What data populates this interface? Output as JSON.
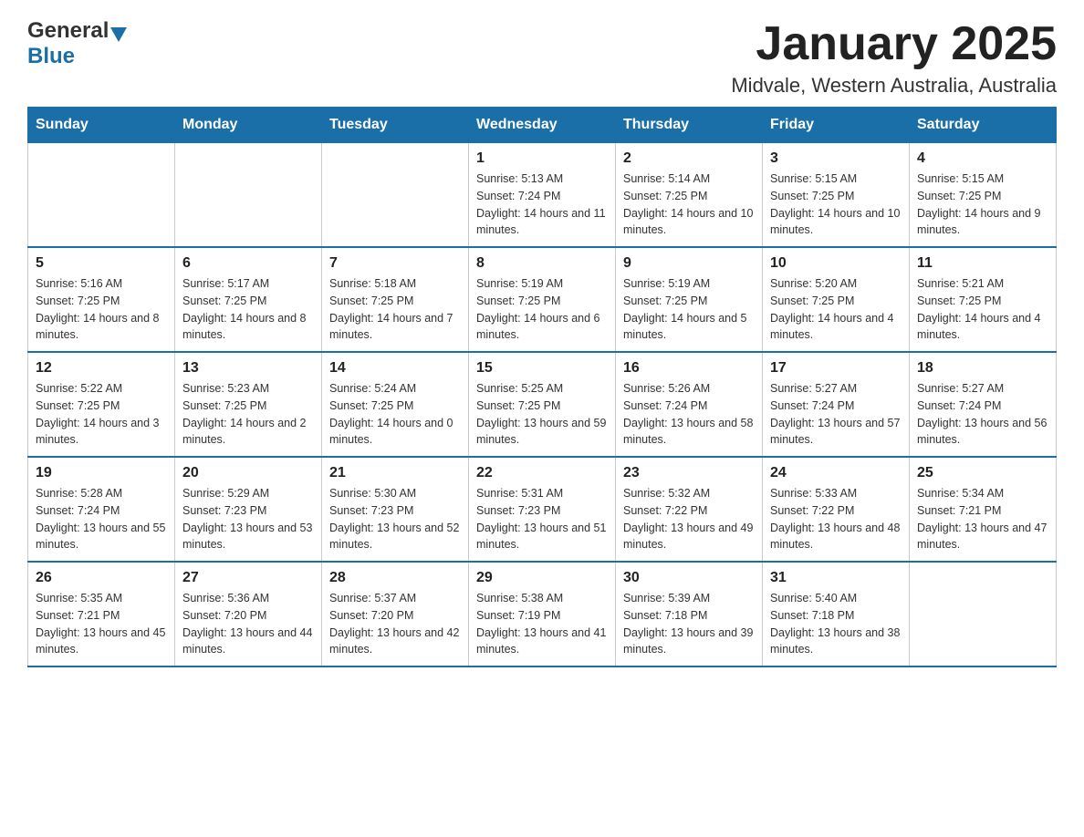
{
  "header": {
    "logo": {
      "general": "General",
      "blue": "Blue"
    },
    "title": "January 2025",
    "subtitle": "Midvale, Western Australia, Australia"
  },
  "calendar": {
    "days_of_week": [
      "Sunday",
      "Monday",
      "Tuesday",
      "Wednesday",
      "Thursday",
      "Friday",
      "Saturday"
    ],
    "weeks": [
      [
        {
          "day": "",
          "sunrise": "",
          "sunset": "",
          "daylight": ""
        },
        {
          "day": "",
          "sunrise": "",
          "sunset": "",
          "daylight": ""
        },
        {
          "day": "",
          "sunrise": "",
          "sunset": "",
          "daylight": ""
        },
        {
          "day": "1",
          "sunrise": "Sunrise: 5:13 AM",
          "sunset": "Sunset: 7:24 PM",
          "daylight": "Daylight: 14 hours and 11 minutes."
        },
        {
          "day": "2",
          "sunrise": "Sunrise: 5:14 AM",
          "sunset": "Sunset: 7:25 PM",
          "daylight": "Daylight: 14 hours and 10 minutes."
        },
        {
          "day": "3",
          "sunrise": "Sunrise: 5:15 AM",
          "sunset": "Sunset: 7:25 PM",
          "daylight": "Daylight: 14 hours and 10 minutes."
        },
        {
          "day": "4",
          "sunrise": "Sunrise: 5:15 AM",
          "sunset": "Sunset: 7:25 PM",
          "daylight": "Daylight: 14 hours and 9 minutes."
        }
      ],
      [
        {
          "day": "5",
          "sunrise": "Sunrise: 5:16 AM",
          "sunset": "Sunset: 7:25 PM",
          "daylight": "Daylight: 14 hours and 8 minutes."
        },
        {
          "day": "6",
          "sunrise": "Sunrise: 5:17 AM",
          "sunset": "Sunset: 7:25 PM",
          "daylight": "Daylight: 14 hours and 8 minutes."
        },
        {
          "day": "7",
          "sunrise": "Sunrise: 5:18 AM",
          "sunset": "Sunset: 7:25 PM",
          "daylight": "Daylight: 14 hours and 7 minutes."
        },
        {
          "day": "8",
          "sunrise": "Sunrise: 5:19 AM",
          "sunset": "Sunset: 7:25 PM",
          "daylight": "Daylight: 14 hours and 6 minutes."
        },
        {
          "day": "9",
          "sunrise": "Sunrise: 5:19 AM",
          "sunset": "Sunset: 7:25 PM",
          "daylight": "Daylight: 14 hours and 5 minutes."
        },
        {
          "day": "10",
          "sunrise": "Sunrise: 5:20 AM",
          "sunset": "Sunset: 7:25 PM",
          "daylight": "Daylight: 14 hours and 4 minutes."
        },
        {
          "day": "11",
          "sunrise": "Sunrise: 5:21 AM",
          "sunset": "Sunset: 7:25 PM",
          "daylight": "Daylight: 14 hours and 4 minutes."
        }
      ],
      [
        {
          "day": "12",
          "sunrise": "Sunrise: 5:22 AM",
          "sunset": "Sunset: 7:25 PM",
          "daylight": "Daylight: 14 hours and 3 minutes."
        },
        {
          "day": "13",
          "sunrise": "Sunrise: 5:23 AM",
          "sunset": "Sunset: 7:25 PM",
          "daylight": "Daylight: 14 hours and 2 minutes."
        },
        {
          "day": "14",
          "sunrise": "Sunrise: 5:24 AM",
          "sunset": "Sunset: 7:25 PM",
          "daylight": "Daylight: 14 hours and 0 minutes."
        },
        {
          "day": "15",
          "sunrise": "Sunrise: 5:25 AM",
          "sunset": "Sunset: 7:25 PM",
          "daylight": "Daylight: 13 hours and 59 minutes."
        },
        {
          "day": "16",
          "sunrise": "Sunrise: 5:26 AM",
          "sunset": "Sunset: 7:24 PM",
          "daylight": "Daylight: 13 hours and 58 minutes."
        },
        {
          "day": "17",
          "sunrise": "Sunrise: 5:27 AM",
          "sunset": "Sunset: 7:24 PM",
          "daylight": "Daylight: 13 hours and 57 minutes."
        },
        {
          "day": "18",
          "sunrise": "Sunrise: 5:27 AM",
          "sunset": "Sunset: 7:24 PM",
          "daylight": "Daylight: 13 hours and 56 minutes."
        }
      ],
      [
        {
          "day": "19",
          "sunrise": "Sunrise: 5:28 AM",
          "sunset": "Sunset: 7:24 PM",
          "daylight": "Daylight: 13 hours and 55 minutes."
        },
        {
          "day": "20",
          "sunrise": "Sunrise: 5:29 AM",
          "sunset": "Sunset: 7:23 PM",
          "daylight": "Daylight: 13 hours and 53 minutes."
        },
        {
          "day": "21",
          "sunrise": "Sunrise: 5:30 AM",
          "sunset": "Sunset: 7:23 PM",
          "daylight": "Daylight: 13 hours and 52 minutes."
        },
        {
          "day": "22",
          "sunrise": "Sunrise: 5:31 AM",
          "sunset": "Sunset: 7:23 PM",
          "daylight": "Daylight: 13 hours and 51 minutes."
        },
        {
          "day": "23",
          "sunrise": "Sunrise: 5:32 AM",
          "sunset": "Sunset: 7:22 PM",
          "daylight": "Daylight: 13 hours and 49 minutes."
        },
        {
          "day": "24",
          "sunrise": "Sunrise: 5:33 AM",
          "sunset": "Sunset: 7:22 PM",
          "daylight": "Daylight: 13 hours and 48 minutes."
        },
        {
          "day": "25",
          "sunrise": "Sunrise: 5:34 AM",
          "sunset": "Sunset: 7:21 PM",
          "daylight": "Daylight: 13 hours and 47 minutes."
        }
      ],
      [
        {
          "day": "26",
          "sunrise": "Sunrise: 5:35 AM",
          "sunset": "Sunset: 7:21 PM",
          "daylight": "Daylight: 13 hours and 45 minutes."
        },
        {
          "day": "27",
          "sunrise": "Sunrise: 5:36 AM",
          "sunset": "Sunset: 7:20 PM",
          "daylight": "Daylight: 13 hours and 44 minutes."
        },
        {
          "day": "28",
          "sunrise": "Sunrise: 5:37 AM",
          "sunset": "Sunset: 7:20 PM",
          "daylight": "Daylight: 13 hours and 42 minutes."
        },
        {
          "day": "29",
          "sunrise": "Sunrise: 5:38 AM",
          "sunset": "Sunset: 7:19 PM",
          "daylight": "Daylight: 13 hours and 41 minutes."
        },
        {
          "day": "30",
          "sunrise": "Sunrise: 5:39 AM",
          "sunset": "Sunset: 7:18 PM",
          "daylight": "Daylight: 13 hours and 39 minutes."
        },
        {
          "day": "31",
          "sunrise": "Sunrise: 5:40 AM",
          "sunset": "Sunset: 7:18 PM",
          "daylight": "Daylight: 13 hours and 38 minutes."
        },
        {
          "day": "",
          "sunrise": "",
          "sunset": "",
          "daylight": ""
        }
      ]
    ]
  }
}
